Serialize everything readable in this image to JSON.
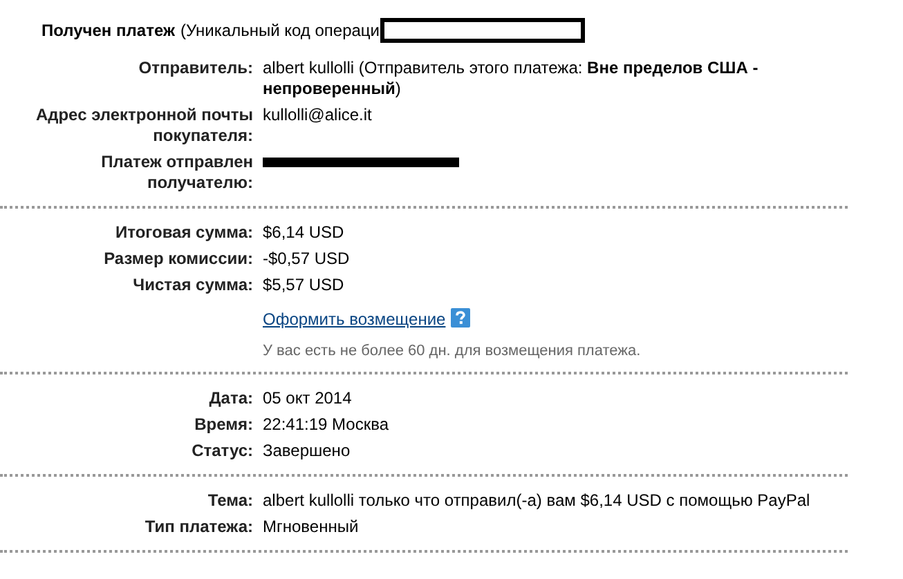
{
  "header": {
    "title": "Получен платеж",
    "note": "(Уникальный код операци"
  },
  "sections": [
    {
      "rows": [
        {
          "kind": "text",
          "label": "Отправитель:",
          "value": "albert kullolli (Отправитель этого платежа: **Вне пределов США - непроверенный**)"
        },
        {
          "kind": "text",
          "label": "Адрес электронной почты покупателя:",
          "value": "kullolli@alice.it"
        },
        {
          "kind": "redacted",
          "label": "Платеж отправлен получателю:"
        }
      ]
    },
    {
      "rows": [
        {
          "kind": "text",
          "label": "Итоговая сумма:",
          "value": "$6,14 USD"
        },
        {
          "kind": "text",
          "label": "Размер комиссии:",
          "value": "-$0,57 USD"
        },
        {
          "kind": "text",
          "label": "Чистая сумма:",
          "value": "$5,57 USD"
        }
      ],
      "refund": {
        "link": "Оформить возмещение",
        "note": "У вас есть не более 60 дн. для возмещения платежа."
      }
    },
    {
      "rows": [
        {
          "kind": "text",
          "label": "Дата:",
          "value": "05 окт 2014"
        },
        {
          "kind": "text",
          "label": "Время:",
          "value": "22:41:19 Москва"
        },
        {
          "kind": "text",
          "label": "Статус:",
          "value": "Завершено"
        }
      ]
    },
    {
      "rows": [
        {
          "kind": "text",
          "label": "Тема:",
          "value": "albert kullolli только что отправил(-а) вам $6,14 USD с помощью PayPal"
        },
        {
          "kind": "text",
          "label": "Тип платежа:",
          "value": "Мгновенный"
        }
      ]
    }
  ]
}
